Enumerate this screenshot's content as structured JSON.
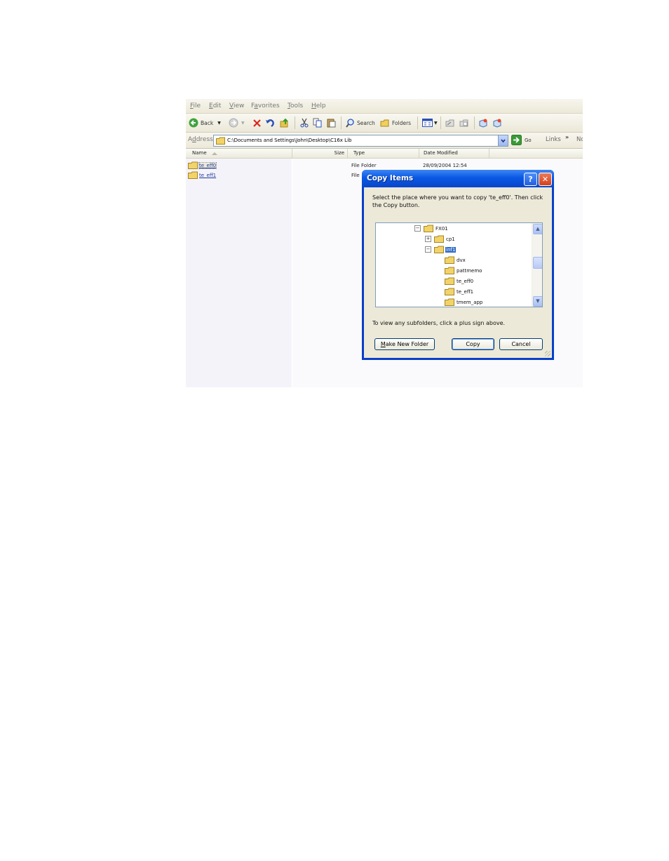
{
  "menubar": {
    "items": [
      {
        "label": "File",
        "mnemonic": "F",
        "rest": "ile"
      },
      {
        "label": "Edit",
        "mnemonic": "E",
        "rest": "dit"
      },
      {
        "label": "View",
        "mnemonic": "V",
        "rest": "iew"
      },
      {
        "label": "Favorites",
        "pre": "F",
        "mnemonic": "a",
        "rest": "vorites"
      },
      {
        "label": "Tools",
        "mnemonic": "T",
        "rest": "ools"
      },
      {
        "label": "Help",
        "mnemonic": "H",
        "rest": "elp"
      }
    ]
  },
  "toolbar": {
    "back_label": "Back",
    "search_label": "Search",
    "folders_label": "Folders"
  },
  "address": {
    "label": "Address",
    "path": "C:\\Documents and Settings\\John\\Desktop\\C16x Lib",
    "go_label": "Go",
    "links_label": "Links",
    "overflow_label": "No"
  },
  "list": {
    "columns": {
      "name": "Name",
      "size": "Size",
      "type": "Type",
      "date": "Date Modified"
    },
    "rows": [
      {
        "name": "te_eff0",
        "type": "File Folder",
        "date": "28/09/2004 12:54",
        "selected": true
      },
      {
        "name": "te_eff1",
        "type": "File",
        "date": "",
        "selected": false
      }
    ]
  },
  "dialog": {
    "title": "Copy Items",
    "help_glyph": "?",
    "close_glyph": "✕",
    "instruction": "Select the place where you want to copy 'te_eff0'. Then click the Copy button.",
    "tree": [
      {
        "label": "FX01",
        "depth": 0,
        "expander": "minus"
      },
      {
        "label": "cp1",
        "depth": 1,
        "expander": "plus"
      },
      {
        "label": "inf1",
        "depth": 1,
        "expander": "minus",
        "selected": true
      },
      {
        "label": "dvx",
        "depth": 2,
        "expander": "none"
      },
      {
        "label": "pattmemo",
        "depth": 2,
        "expander": "none"
      },
      {
        "label": "te_eff0",
        "depth": 2,
        "expander": "none"
      },
      {
        "label": "te_eff1",
        "depth": 2,
        "expander": "none"
      },
      {
        "label": "tmem_app",
        "depth": 2,
        "expander": "none"
      }
    ],
    "hint": "To view any subfolders, click a plus sign above.",
    "make_folder_pre": "",
    "make_folder_mnemonic": "M",
    "make_folder_rest": "ake New Folder",
    "copy_label": "Copy",
    "cancel_label": "Cancel"
  },
  "colors": {
    "dialog_title": "#0a58e5",
    "dialog_face": "#ece9d8",
    "selection": "#316ac5",
    "close_button": "#e1532e",
    "link_text": "#1b3a9b"
  }
}
